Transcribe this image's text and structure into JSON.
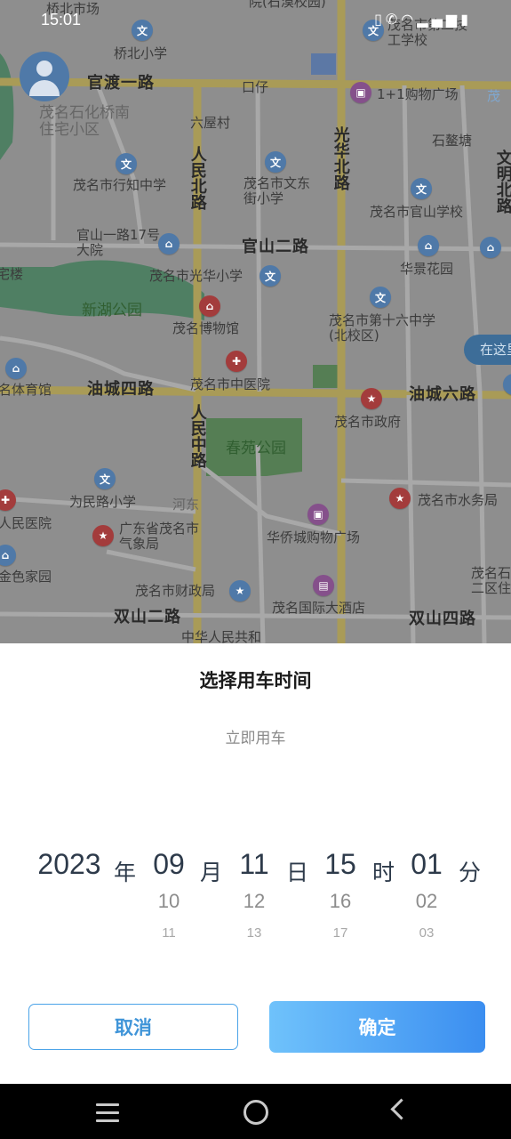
{
  "status_bar": {
    "time": "15:01",
    "icons": [
      "vibrate-icon",
      "phone-call-icon",
      "wifi-icon",
      "signal-icon",
      "battery-icon"
    ]
  },
  "map": {
    "roads": {
      "guandu1": "官渡一路",
      "guanshan2": "官山二路",
      "youcheng4": "油城四路",
      "youcheng6": "油城六路",
      "shuangshan2": "双山二路",
      "shuangshan4": "双山四路",
      "renmin_north": "人民北路",
      "renmin_middle": "人民中路",
      "guanghua_north": "光华北路",
      "wenming_north": "文明北路",
      "hedong": "河东"
    },
    "places": {
      "qiaobei_market": "桥北市场",
      "yuan_top": "院(石漠校园)",
      "maoming_tech": "茂名市第二技工学校",
      "qiaobei_primary": "桥北小学",
      "shop_1plus1": "1+1购物广场",
      "mao_right": "茂",
      "kouzai": "口仔",
      "maoming_petro": "茂名石化桥南住宅小区",
      "liuwu_village": "六屋村",
      "shiaotang": "石鳌塘",
      "xingzhi_middle": "茂名市行知中学",
      "wendong_primary": "茂名市文东街小学",
      "guanshan_school": "茂名市官山学校",
      "guanshan1_17": "官山一路17号大院",
      "huajing_garden": "华景花园",
      "zhailou": "宅楼",
      "guanghua_primary": "茂名市光华小学",
      "xinhu_park": "新湖公园",
      "museum": "茂名博物馆",
      "no16_middle": "茂名市第十六中学(北校区)",
      "sports_hall": "名体育馆",
      "tcm_hospital": "茂名市中医院",
      "city_gov": "茂名市政府",
      "chunyuan_park": "春苑公园",
      "weimin_primary": "为民路小学",
      "water_bureau": "茂名市水务局",
      "peoples_hospital": "人民医院",
      "weather_bureau": "广东省茂名市气象局",
      "huaqiao_plaza": "华侨城购物广场",
      "jinse_home": "金色家园",
      "finance_bureau": "茂名市财政局",
      "intl_hotel": "茂名国际大酒店",
      "maoming_er": "茂名石二区住",
      "zhonghua": "中华人民共和"
    },
    "here_button": "在这里"
  },
  "sheet": {
    "title": "选择用车时间",
    "now_option": "立即用车",
    "picker": {
      "year": {
        "selected": "2023",
        "unit": "年"
      },
      "month": {
        "selected": "09",
        "next1": "10",
        "next2": "11",
        "unit": "月"
      },
      "day": {
        "selected": "11",
        "next1": "12",
        "next2": "13",
        "unit": "日"
      },
      "hour": {
        "selected": "15",
        "next1": "16",
        "next2": "17",
        "unit": "时"
      },
      "minute": {
        "selected": "01",
        "next1": "02",
        "next2": "03",
        "unit": "分"
      }
    },
    "cancel_label": "取消",
    "confirm_label": "确定"
  },
  "nav_bar": {
    "icons": [
      "menu-icon",
      "home-icon",
      "back-icon"
    ]
  }
}
